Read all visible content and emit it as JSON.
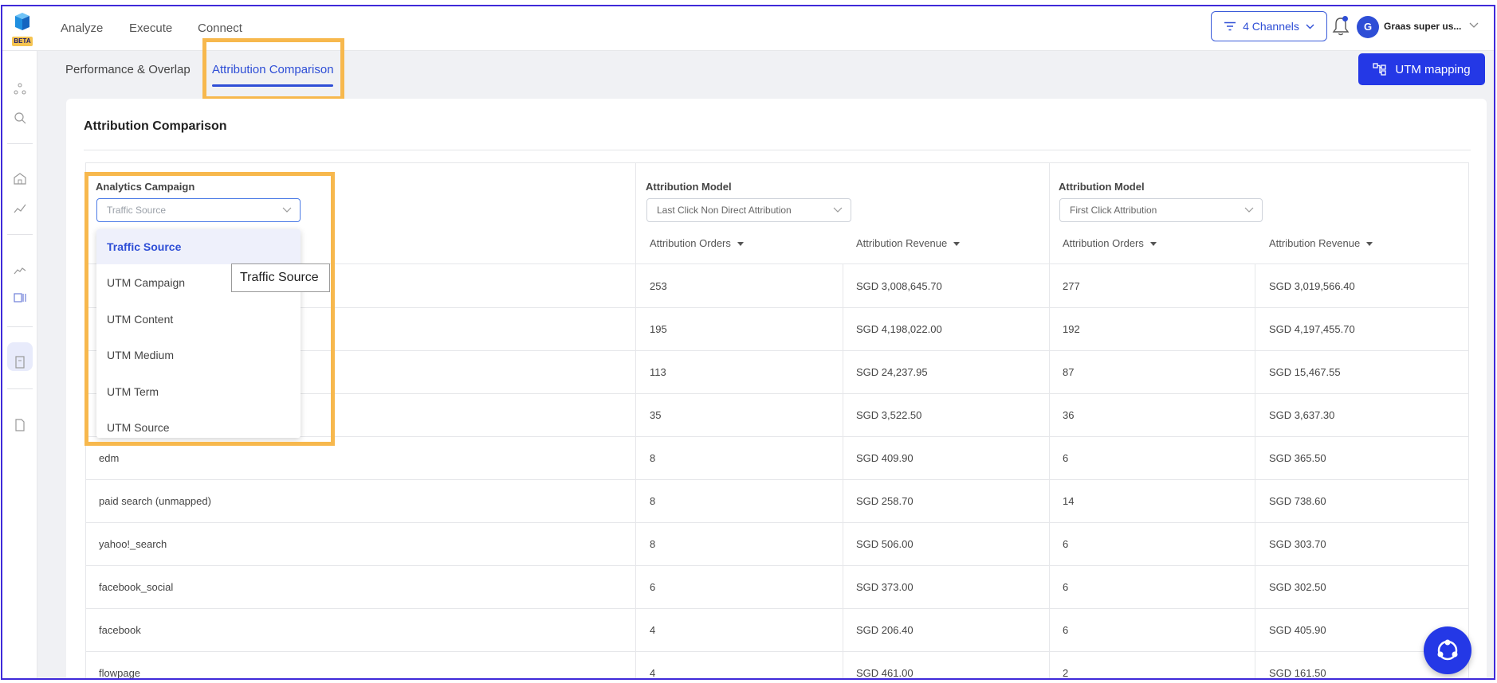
{
  "app": {
    "badge": "BETA",
    "nav": [
      "Analyze",
      "Execute",
      "Connect"
    ]
  },
  "header": {
    "channels_label": "4 Channels",
    "avatar_initial": "G",
    "user_name": "Graas super us..."
  },
  "tabs": [
    "Performance & Overlap",
    "Attribution Comparison"
  ],
  "utm_button_label": "UTM mapping",
  "card": {
    "title": "Attribution Comparison"
  },
  "table": {
    "group_headers": [
      "Analytics Campaign",
      "Attribution Model",
      "Attribution Model"
    ],
    "campaign_select": {
      "placeholder": "Traffic Source"
    },
    "model_selects": [
      "Last Click Non Direct Attribution",
      "First Click Attribution"
    ],
    "sub_headers": [
      "Attribution Orders",
      "Attribution Revenue",
      "Attribution Orders",
      "Attribution Revenue"
    ],
    "rows": [
      [
        "",
        "253",
        "SGD 3,008,645.70",
        "277",
        "SGD 3,019,566.40"
      ],
      [
        "",
        "195",
        "SGD 4,198,022.00",
        "192",
        "SGD 4,197,455.70"
      ],
      [
        "",
        "113",
        "SGD 24,237.95",
        "87",
        "SGD 15,467.55"
      ],
      [
        "",
        "35",
        "SGD 3,522.50",
        "36",
        "SGD 3,637.30"
      ],
      [
        "edm",
        "8",
        "SGD 409.90",
        "6",
        "SGD 365.50"
      ],
      [
        "paid search (unmapped)",
        "8",
        "SGD 258.70",
        "14",
        "SGD 738.60"
      ],
      [
        "yahoo!_search",
        "8",
        "SGD 506.00",
        "6",
        "SGD 303.70"
      ],
      [
        "facebook_social",
        "6",
        "SGD 373.00",
        "6",
        "SGD 302.50"
      ],
      [
        "facebook",
        "4",
        "SGD 206.40",
        "6",
        "SGD 405.90"
      ],
      [
        "flowpage",
        "4",
        "SGD 461.00",
        "2",
        "SGD 161.50"
      ]
    ]
  },
  "dropdown": {
    "options": [
      "Traffic Source",
      "UTM Campaign",
      "UTM Content",
      "UTM Medium",
      "UTM Term",
      "UTM Source"
    ],
    "selected": "Traffic Source",
    "tooltip": "Traffic Source"
  },
  "colors": {
    "accent": "#2438e6",
    "highlight": "#f7b84d",
    "frame": "#3f2ad9"
  }
}
